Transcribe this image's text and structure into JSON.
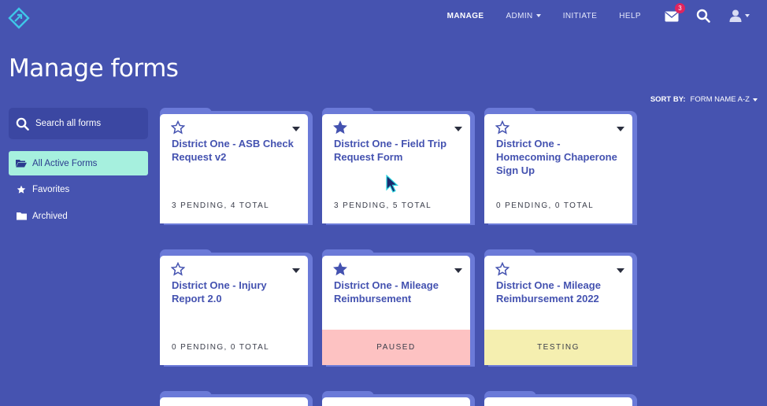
{
  "nav": {
    "items": [
      {
        "label": "MANAGE",
        "active": true,
        "dropdown": false
      },
      {
        "label": "ADMIN",
        "active": false,
        "dropdown": true
      },
      {
        "label": "INITIATE",
        "active": false,
        "dropdown": false
      },
      {
        "label": "HELP",
        "active": false,
        "dropdown": false
      }
    ],
    "mail_badge": "3",
    "icons": [
      "logo-icon",
      "mail-icon",
      "search-icon",
      "user-icon"
    ]
  },
  "page_title": "Manage forms",
  "sort": {
    "label": "SORT BY:",
    "value": "FORM NAME A-Z"
  },
  "sidebar": {
    "search_placeholder": "Search all forms",
    "items": [
      {
        "label": "All Active Forms",
        "icon": "folder-open-icon",
        "active": true
      },
      {
        "label": "Favorites",
        "icon": "star-icon",
        "active": false
      },
      {
        "label": "Archived",
        "icon": "folder-icon",
        "active": false
      }
    ]
  },
  "cards": [
    {
      "title": "District One - ASB Check Request v2",
      "stats": "3 PENDING, 4 TOTAL",
      "favorite": false,
      "status": ""
    },
    {
      "title": "District One - Field Trip Request Form",
      "stats": "3 PENDING, 5 TOTAL",
      "favorite": true,
      "status": ""
    },
    {
      "title": "District One - Homecoming Chaperone Sign Up",
      "stats": "0 PENDING, 0 TOTAL",
      "favorite": false,
      "status": ""
    },
    {
      "title": "District One - Injury Report 2.0",
      "stats": "0 PENDING, 0 TOTAL",
      "favorite": false,
      "status": ""
    },
    {
      "title": "District One - Mileage Reimbursement",
      "stats": "",
      "favorite": true,
      "status": "PAUSED"
    },
    {
      "title": "District One - Mileage Reimbursement 2022",
      "stats": "",
      "favorite": false,
      "status": "TESTING"
    }
  ],
  "colors": {
    "background": "#4653b0",
    "accent_active": "#a6f0de",
    "card_title": "#4452b0",
    "paused": "#fdc2c2",
    "testing": "#f5efb0",
    "badge": "#e0245e"
  }
}
